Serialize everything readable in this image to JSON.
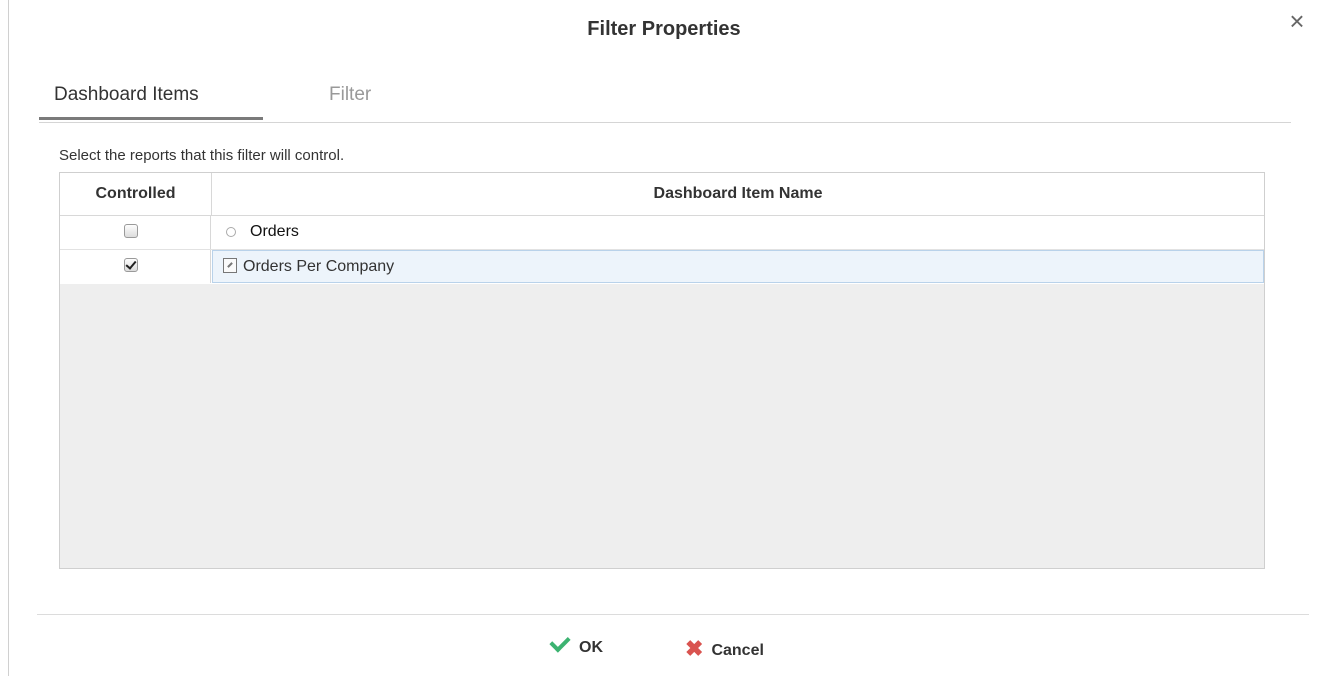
{
  "dialog": {
    "title": "Filter Properties",
    "close_glyph": "×"
  },
  "tabs": [
    {
      "label": "Dashboard Items",
      "active": true
    },
    {
      "label": "Filter",
      "active": false
    }
  ],
  "description": "Select the reports that this filter will control.",
  "grid": {
    "headers": [
      "Controlled",
      "Dashboard Item Name"
    ],
    "rows": [
      {
        "controlled": false,
        "name": "Orders",
        "icon": "circle-icon"
      },
      {
        "controlled": true,
        "name": "Orders Per Company",
        "icon": "report-icon",
        "selected": true
      }
    ]
  },
  "footer": {
    "ok_label": "OK",
    "cancel_label": "Cancel",
    "cancel_glyph": "✖"
  },
  "colors": {
    "ok_icon": "#3cb371",
    "cancel_icon": "#d9534f",
    "selected_row_bg": "#edf4fb",
    "grid_empty_bg": "#eeeeee"
  }
}
